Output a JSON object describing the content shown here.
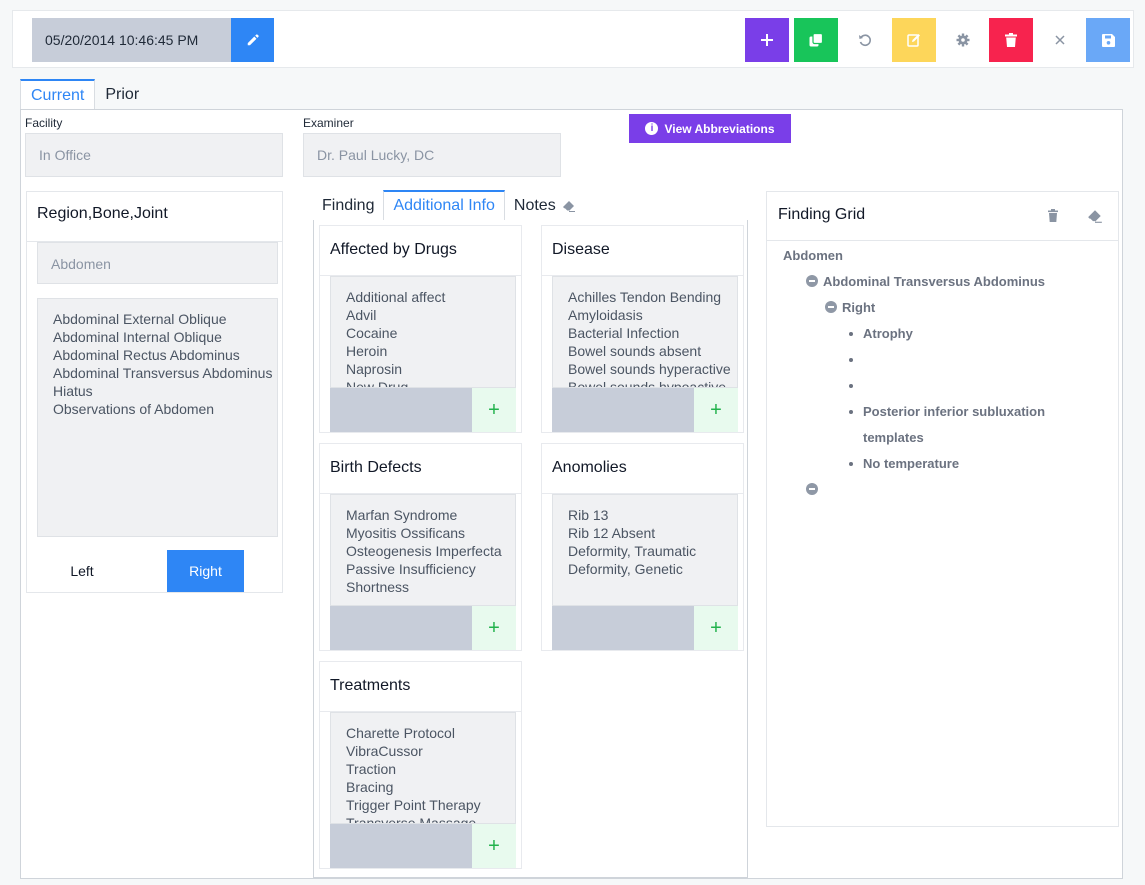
{
  "toolbar": {
    "datetime": "05/20/2014 10:46:45 PM",
    "colors": {
      "add": "#7a3ee8",
      "copy": "#18c55a",
      "edit": "#fdd65a",
      "delete": "#f7234e",
      "save": "#6aa8f7",
      "primary": "#2e86f5"
    }
  },
  "tabs": {
    "current": "Current",
    "prior": "Prior"
  },
  "form": {
    "facility_label": "Facility",
    "facility_value": "In Office",
    "examiner_label": "Examiner",
    "examiner_value": "Dr. Paul Lucky, DC",
    "view_abbreviations": "View Abbreviations"
  },
  "region": {
    "title": "Region,Bone,Joint",
    "selected": "Abdomen",
    "items": [
      "Abdominal External Oblique",
      "Abdominal Internal Oblique",
      "Abdominal Rectus Abdominus",
      "Abdominal Transversus Abdominus",
      "Hiatus",
      "Observations of Abdomen"
    ],
    "left": "Left",
    "right": "Right"
  },
  "middle_tabs": {
    "finding": "Finding",
    "additional": "Additional Info",
    "notes": "Notes"
  },
  "cards": {
    "drugs": {
      "title": "Affected by Drugs",
      "items": [
        "Additional affect",
        "Advil",
        "Cocaine",
        "Heroin",
        "Naprosin",
        "New Drug"
      ]
    },
    "disease": {
      "title": "Disease",
      "items": [
        "Achilles Tendon Bending",
        "Amyloidasis",
        "Bacterial Infection",
        "Bowel sounds absent",
        "Bowel sounds hyperactive",
        "Bowel sounds hypoactive"
      ]
    },
    "birth": {
      "title": "Birth Defects",
      "items": [
        "Marfan Syndrome",
        "Myositis Ossificans",
        "Osteogenesis Imperfecta",
        "Passive Insufficiency",
        "Shortness"
      ]
    },
    "anomalies": {
      "title": "Anomolies",
      "items": [
        "Rib 13",
        "Rib 12 Absent",
        "Deformity, Traumatic",
        "Deformity, Genetic"
      ]
    },
    "treatments": {
      "title": "Treatments",
      "items": [
        "Charette Protocol",
        "VibraCussor",
        "Traction",
        "Bracing",
        "Trigger Point Therapy",
        "Transverse Massage"
      ]
    },
    "add_symbol": "+"
  },
  "finding_grid": {
    "title": "Finding Grid",
    "root": "Abdomen",
    "muscle": "Abdominal Transversus Abdominus",
    "side": "Right",
    "findings": [
      "Atrophy",
      "",
      "",
      "Posterior inferior subluxation",
      "templates",
      "No temperature"
    ]
  }
}
